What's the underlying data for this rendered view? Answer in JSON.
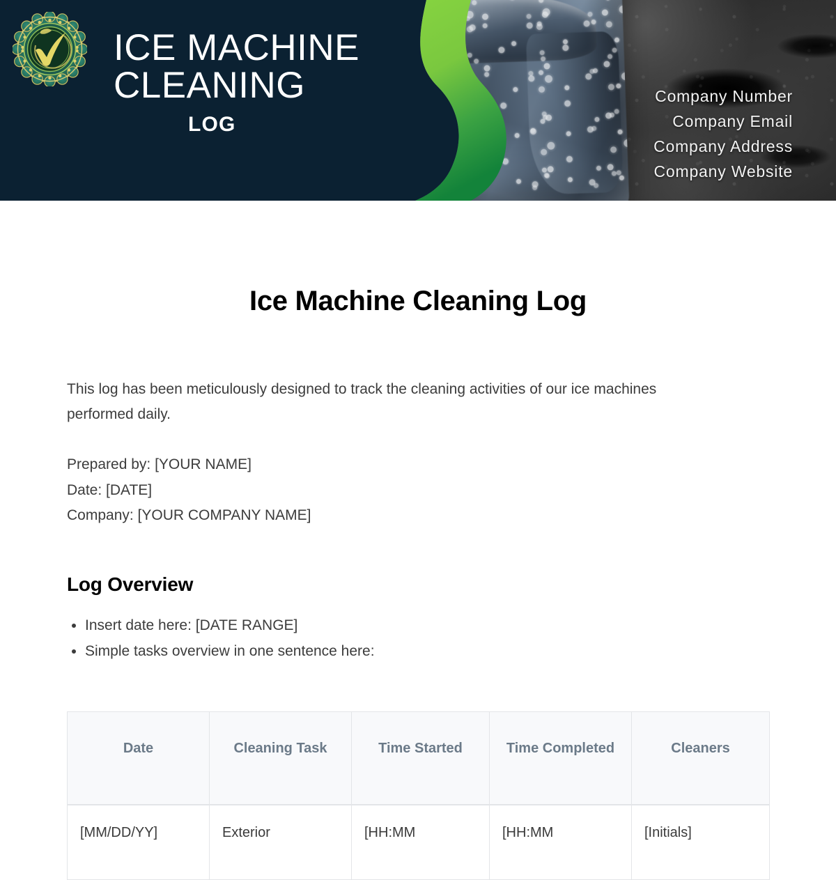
{
  "banner": {
    "logo_icon": "check-badge-seal-icon",
    "title_main": "ICE MACHINE\nCLEANING",
    "title_sub": "LOG",
    "contact": [
      "Company Number",
      "Company Email",
      "Company Address",
      "Company Website"
    ],
    "colors": {
      "navy": "#0b2132",
      "green_light": "#7ec841",
      "green_dark": "#1d8a3a",
      "badge_teal": "#2b7b6d",
      "badge_gold": "#e4d766"
    }
  },
  "document": {
    "title": "Ice Machine Cleaning Log",
    "intro": "This log has been meticulously designed to track the cleaning activities of our ice machines performed daily.",
    "meta": {
      "prepared_by": "Prepared by: [YOUR NAME]",
      "date": "Date: [DATE]",
      "company": "Company: [YOUR COMPANY NAME]"
    },
    "overview": {
      "heading": "Log Overview",
      "bullets": [
        "Insert date here: [DATE RANGE]",
        "Simple tasks overview in one sentence here:"
      ]
    },
    "table": {
      "headers": [
        "Date",
        "Cleaning Task",
        "Time Started",
        "Time Completed",
        "Cleaners"
      ],
      "rows": [
        {
          "date": "[MM/DD/YY]",
          "task": "Exterior",
          "time_started": "[HH:MM",
          "time_completed": "[HH:MM",
          "cleaners": "[Initials]"
        }
      ]
    }
  }
}
